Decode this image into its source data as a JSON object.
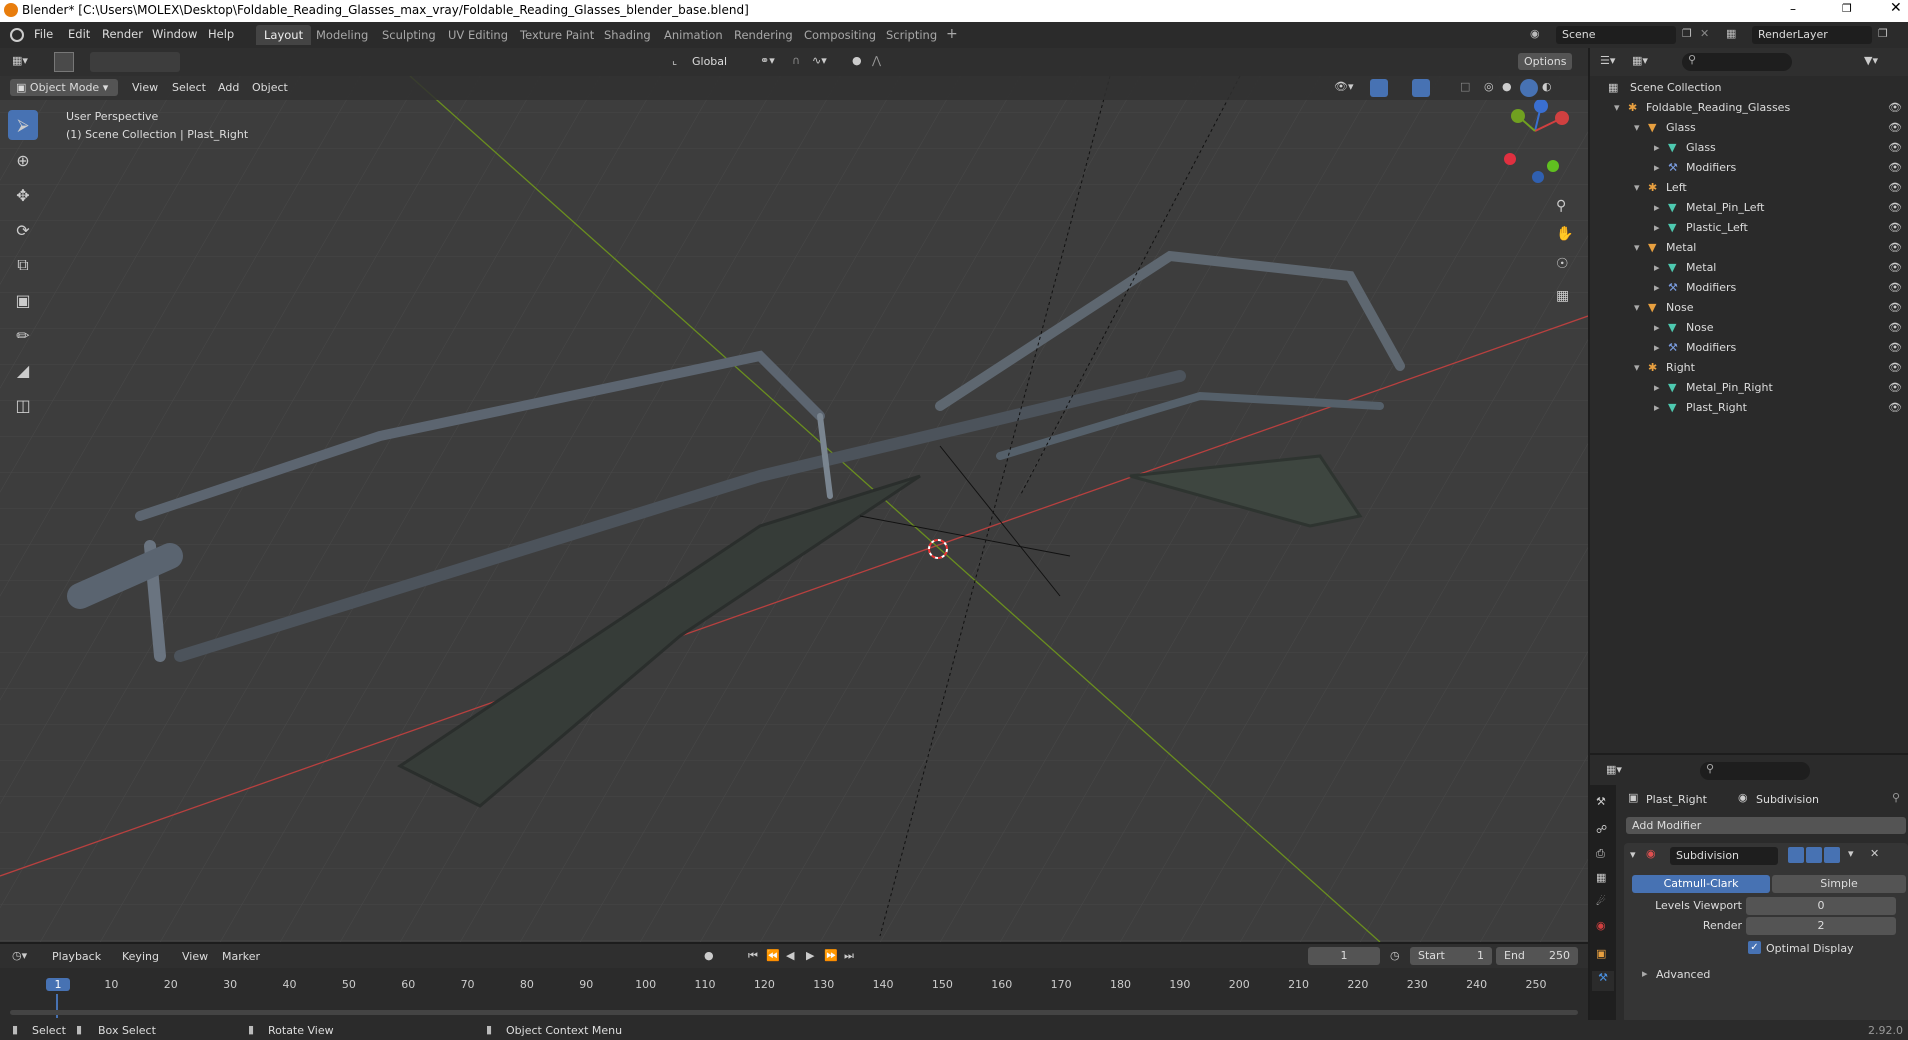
{
  "title": "Blender* [C:\\Users\\MOLEX\\Desktop\\Foldable_Reading_Glasses_max_vray/Foldable_Reading_Glasses_blender_base.blend]",
  "menus": [
    "File",
    "Edit",
    "Render",
    "Window",
    "Help"
  ],
  "workspaces": [
    "Layout",
    "Modeling",
    "Sculpting",
    "UV Editing",
    "Texture Paint",
    "Shading",
    "Animation",
    "Rendering",
    "Compositing",
    "Scripting"
  ],
  "scene": "Scene",
  "renderlayer": "RenderLayer",
  "viewport": {
    "mode": "Object Mode",
    "menu": [
      "View",
      "Select",
      "Add",
      "Object"
    ],
    "transform": "Global",
    "options": "Options",
    "perspective": "User Perspective",
    "collection": "(1) Scene Collection | Plast_Right"
  },
  "outliner": {
    "root": "Scene Collection",
    "items": [
      {
        "label": "Foldable_Reading_Glasses",
        "depth": 1
      },
      {
        "label": "Glass",
        "depth": 2
      },
      {
        "label": "Glass",
        "depth": 3
      },
      {
        "label": "Modifiers",
        "depth": 3
      },
      {
        "label": "Left",
        "depth": 2
      },
      {
        "label": "Metal_Pin_Left",
        "depth": 3
      },
      {
        "label": "Plastic_Left",
        "depth": 3
      },
      {
        "label": "Metal",
        "depth": 2
      },
      {
        "label": "Metal",
        "depth": 3
      },
      {
        "label": "Modifiers",
        "depth": 3
      },
      {
        "label": "Nose",
        "depth": 2
      },
      {
        "label": "Nose",
        "depth": 3
      },
      {
        "label": "Modifiers",
        "depth": 3
      },
      {
        "label": "Right",
        "depth": 2
      },
      {
        "label": "Metal_Pin_Right",
        "depth": 3
      },
      {
        "label": "Plast_Right",
        "depth": 3
      }
    ]
  },
  "properties": {
    "object": "Plast_Right",
    "modifier_tab": "Subdivision",
    "add_modifier": "Add Modifier",
    "modifier_name": "Subdivision",
    "catmull": "Catmull-Clark",
    "simple": "Simple",
    "levels_label": "Levels Viewport",
    "levels_value": "0",
    "render_label": "Render",
    "render_value": "2",
    "optimal": "Optimal Display",
    "advanced": "Advanced"
  },
  "timeline": {
    "menus": [
      "Playback",
      "Keying",
      "View",
      "Marker"
    ],
    "current": "1",
    "start_label": "Start",
    "start": "1",
    "end_label": "End",
    "end": "250",
    "ticks": [
      "1",
      "10",
      "20",
      "30",
      "40",
      "50",
      "60",
      "70",
      "80",
      "90",
      "100",
      "110",
      "120",
      "130",
      "140",
      "150",
      "160",
      "170",
      "180",
      "190",
      "200",
      "210",
      "220",
      "230",
      "240",
      "250"
    ]
  },
  "status": {
    "select": "Select",
    "box": "Box Select",
    "rotate": "Rotate View",
    "context": "Object Context Menu",
    "version": "2.92.0"
  }
}
